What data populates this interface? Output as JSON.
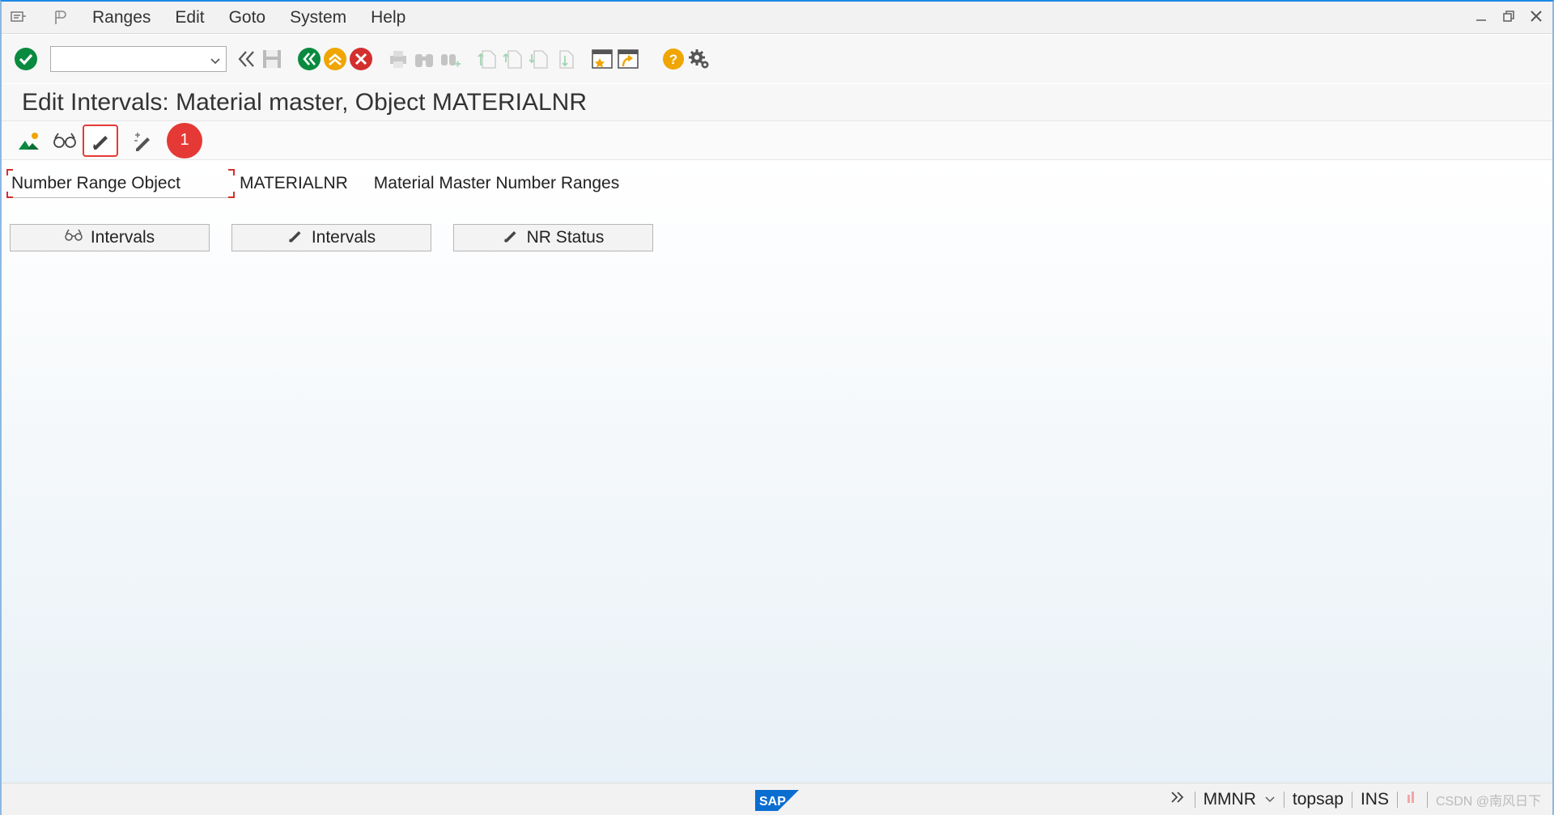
{
  "menubar": {
    "items": [
      {
        "label": "Ranges"
      },
      {
        "label": "Edit"
      },
      {
        "label": "Goto"
      },
      {
        "label": "System"
      },
      {
        "label": "Help"
      }
    ]
  },
  "toolbar": {
    "command_value": "",
    "icons": [
      "enter-icon",
      "back-double-icon",
      "save-icon",
      "back-icon",
      "exit-icon",
      "cancel-icon",
      "print-icon",
      "find-icon",
      "find-next-icon",
      "first-page-icon",
      "previous-page-icon",
      "next-page-icon",
      "last-page-icon",
      "new-session-icon",
      "shortcut-icon",
      "help-icon",
      "settings-icon"
    ]
  },
  "title": "Edit Intervals: Material master, Object MATERIALNR",
  "app_toolbar": {
    "callout_number": "1",
    "icons": [
      "overview-icon",
      "display-icon",
      "change-icon",
      "maintain-icon"
    ]
  },
  "object_row": {
    "label": "Number Range Object",
    "value": "MATERIALNR",
    "description": "Material Master Number Ranges"
  },
  "buttons": [
    {
      "label": "Intervals",
      "icon": "glasses-icon"
    },
    {
      "label": "Intervals",
      "icon": "pencil-icon"
    },
    {
      "label": "NR Status",
      "icon": "pencil-icon"
    }
  ],
  "statusbar": {
    "transaction": "MMNR",
    "server": "topsap",
    "mode": "INS",
    "watermark": "CSDN @南风日下"
  },
  "colors": {
    "accent_green": "#0a8a3f",
    "accent_orange": "#f0a500",
    "accent_red": "#d32f2f",
    "highlight_red": "#e53935"
  }
}
